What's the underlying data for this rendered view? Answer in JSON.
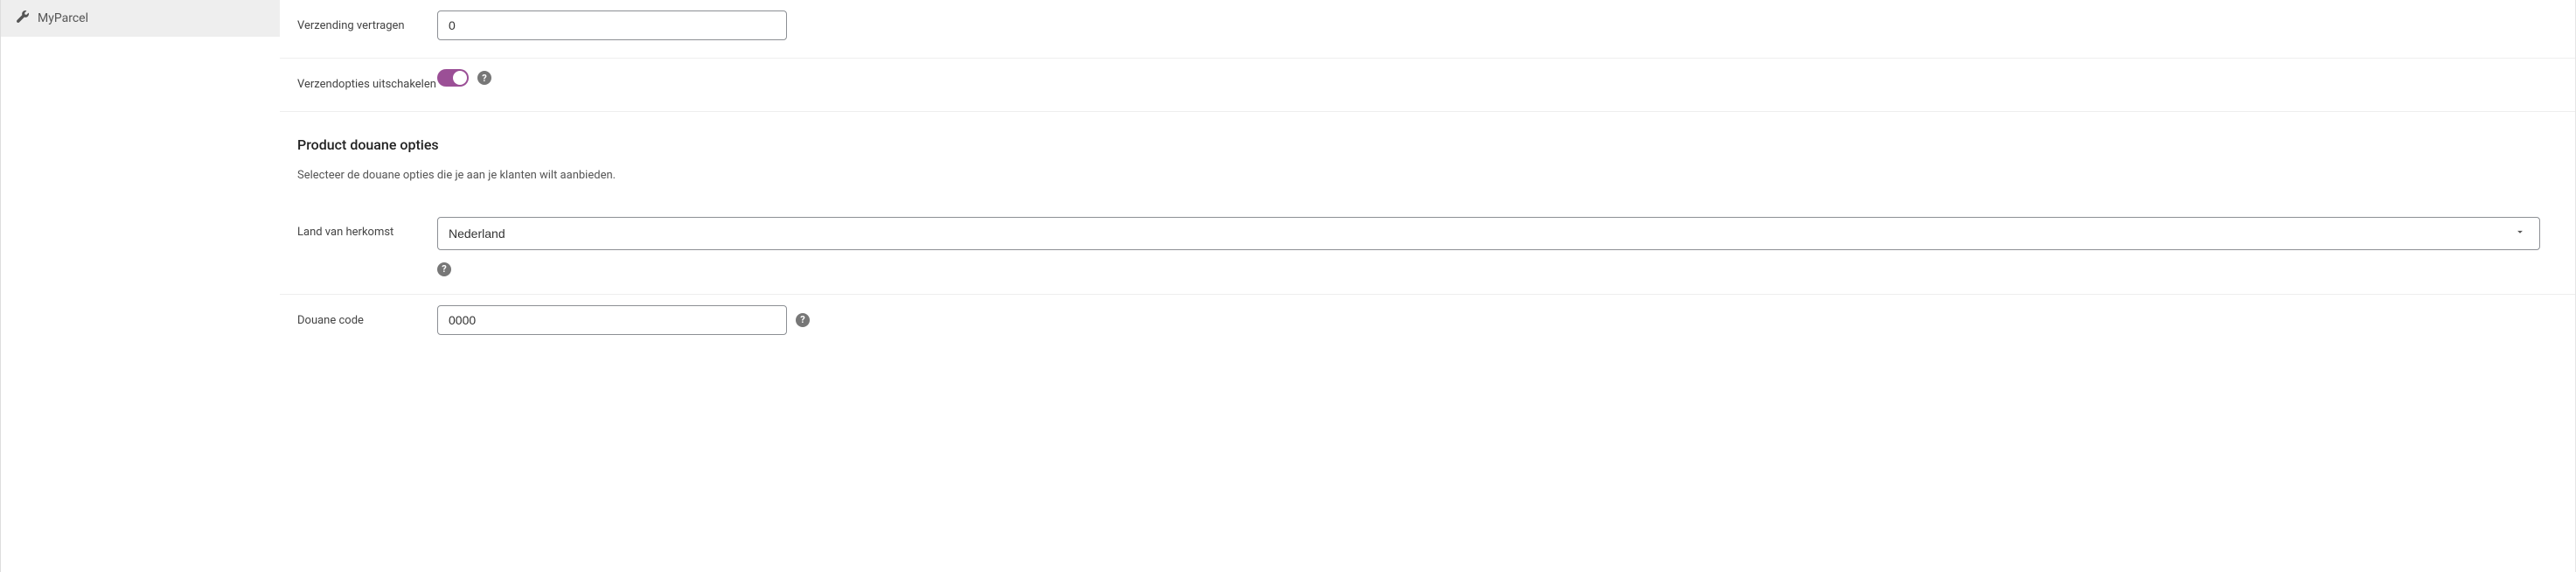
{
  "sidebar": {
    "items": [
      {
        "label": "MyParcel"
      }
    ]
  },
  "form": {
    "delay_shipping": {
      "label": "Verzending vertragen",
      "value": "0"
    },
    "disable_shipping_options": {
      "label": "Verzendopties uitschakelen",
      "enabled": true
    },
    "customs_section": {
      "title": "Product douane opties",
      "description": "Selecteer de douane opties die je aan je klanten wilt aanbieden."
    },
    "country_of_origin": {
      "label": "Land van herkomst",
      "value": "Nederland"
    },
    "customs_code": {
      "label": "Douane code",
      "value": "0000"
    }
  }
}
